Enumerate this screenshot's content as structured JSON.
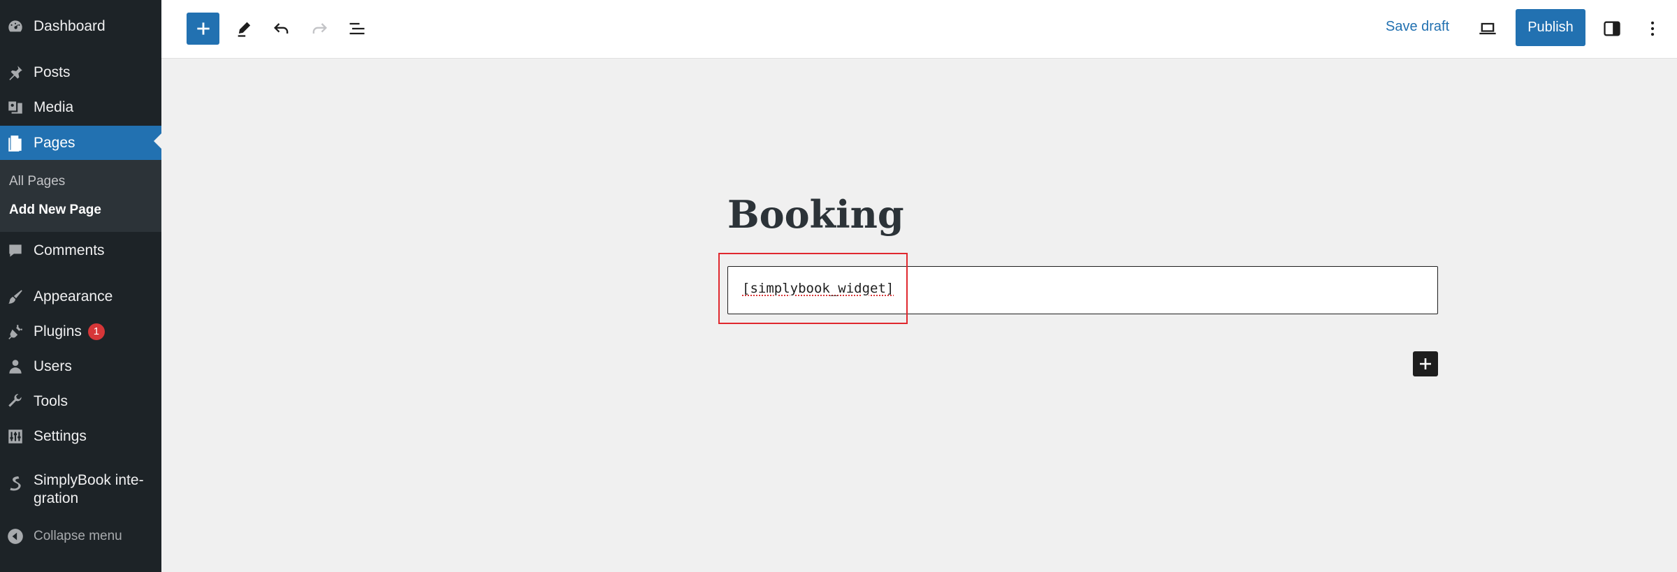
{
  "sidebar": {
    "items": [
      {
        "label": "Dashboard",
        "icon": "dashboard-icon"
      },
      {
        "label": "Posts",
        "icon": "pushpin-icon"
      },
      {
        "label": "Media",
        "icon": "media-icon"
      },
      {
        "label": "Pages",
        "icon": "pages-icon",
        "active": true
      },
      {
        "label": "Comments",
        "icon": "comment-icon"
      },
      {
        "label": "Appearance",
        "icon": "paintbrush-icon"
      },
      {
        "label": "Plugins",
        "icon": "plugin-icon",
        "badge": "1"
      },
      {
        "label": "Users",
        "icon": "user-icon"
      },
      {
        "label": "Tools",
        "icon": "wrench-icon"
      },
      {
        "label": "Settings",
        "icon": "settings-icon"
      },
      {
        "label": "SimplyBook inte-\ngration",
        "icon": "simplybook-icon"
      }
    ],
    "submenu": {
      "all_pages": "All Pages",
      "add_new_page": "Add New Page"
    },
    "collapse_label": "Collapse menu"
  },
  "toolbar": {
    "save_draft": "Save draft",
    "publish": "Publish"
  },
  "editor": {
    "title": "Booking",
    "shortcode_value": "[simplybook_widget]"
  },
  "colors": {
    "sidebar_bg": "#1d2327",
    "accent": "#2271b1",
    "highlight": "#e0282e",
    "badge": "#d63638"
  }
}
